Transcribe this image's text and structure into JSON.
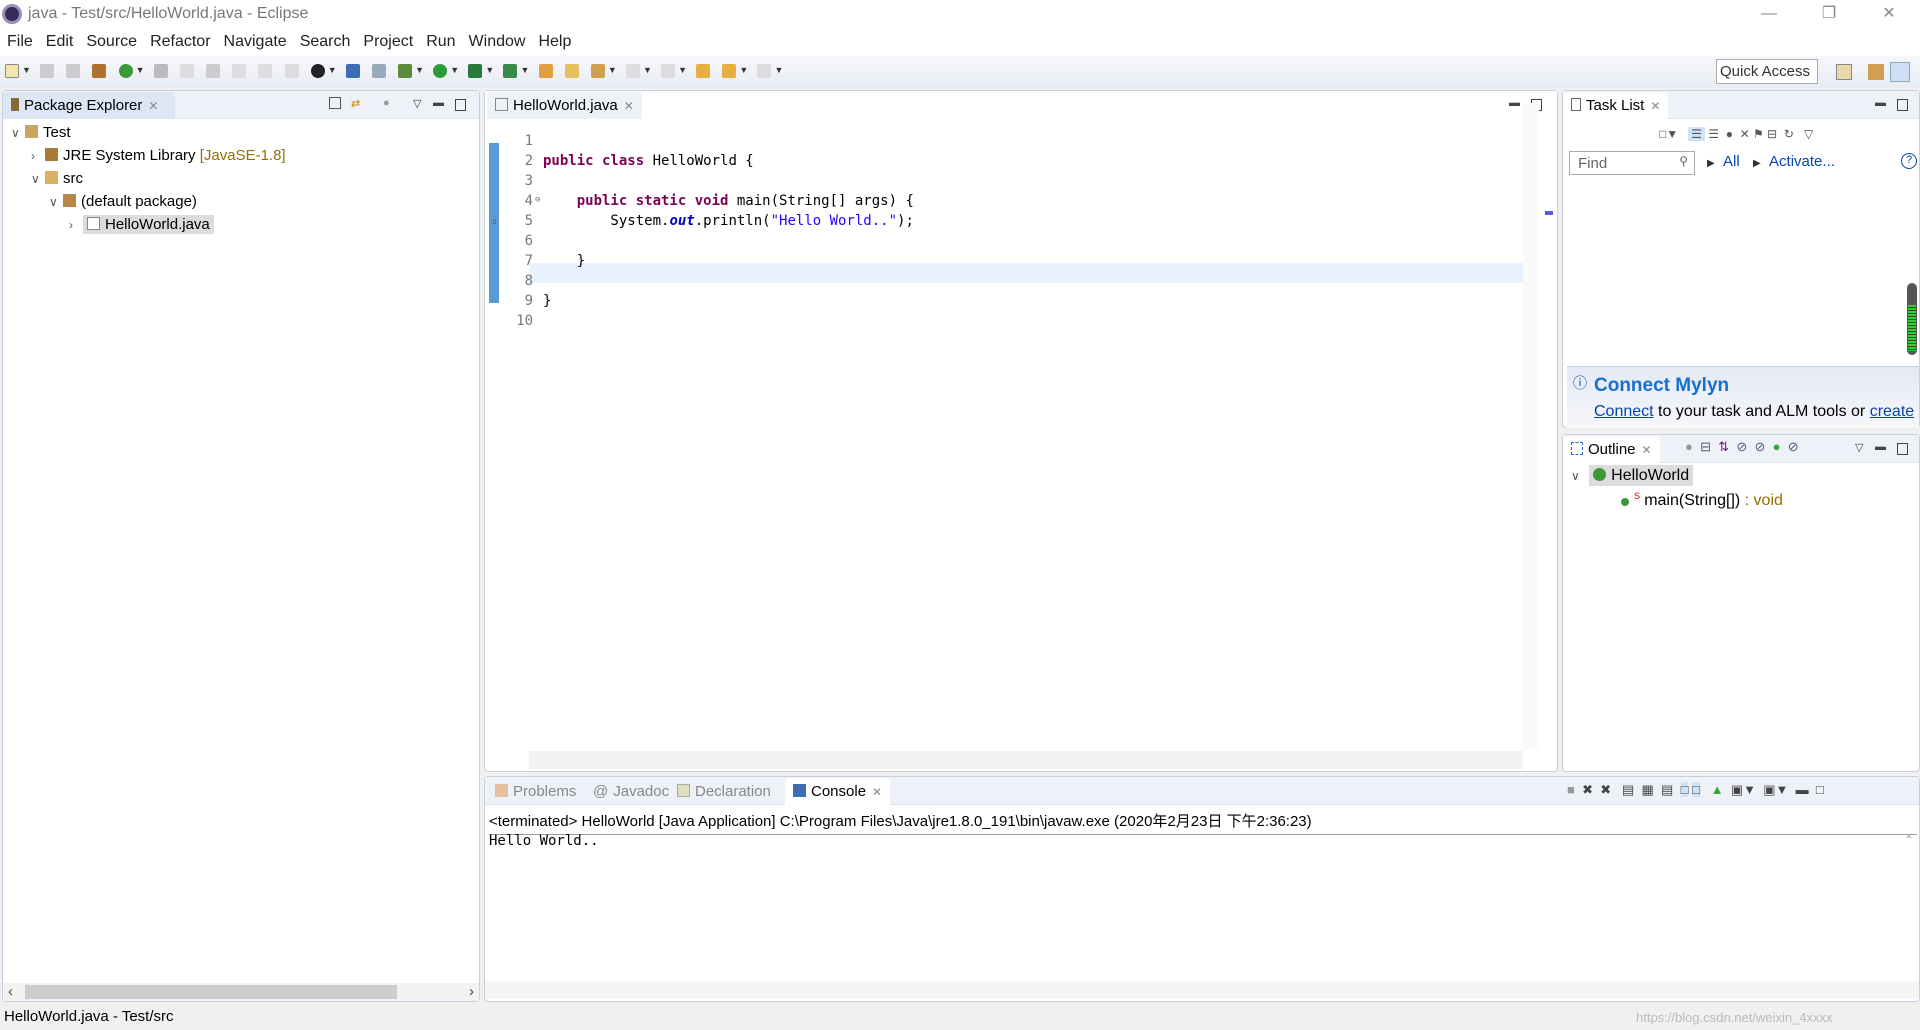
{
  "window": {
    "title": "java - Test/src/HelloWorld.java - Eclipse"
  },
  "menu": [
    "File",
    "Edit",
    "Source",
    "Refactor",
    "Navigate",
    "Search",
    "Project",
    "Run",
    "Window",
    "Help"
  ],
  "toolbar": {
    "quick_access": "Quick Access"
  },
  "package_explorer": {
    "tab": "Package Explorer",
    "tree": [
      {
        "label": "Test",
        "icon": "project-icon"
      },
      {
        "label": "JRE System Library",
        "decoration": "[JavaSE-1.8]",
        "icon": "library-icon"
      },
      {
        "label": "src",
        "icon": "source-folder-icon"
      },
      {
        "label": "(default package)",
        "icon": "package-icon"
      },
      {
        "label": "HelloWorld.java",
        "icon": "java-file-icon",
        "selected": true
      }
    ]
  },
  "editor": {
    "tab": "HelloWorld.java",
    "lines": [
      {
        "n": "1"
      },
      {
        "n": "2"
      },
      {
        "n": "3"
      },
      {
        "n": "4"
      },
      {
        "n": "5"
      },
      {
        "n": "6"
      },
      {
        "n": "7"
      },
      {
        "n": "8"
      },
      {
        "n": "9"
      },
      {
        "n": "10"
      }
    ],
    "code": {
      "l2a": "public class",
      "l2b": " HelloWorld {",
      "l4a": "    public static void",
      "l4b": " main(String[] args) {",
      "l5a": "        System.",
      "l5b": "out",
      "l5c": ".println(",
      "l5d": "\"Hello World..\"",
      "l5e": ");",
      "l7": "    }",
      "l9": "}"
    },
    "current_line": "8"
  },
  "task_list": {
    "tab": "Task List",
    "find_placeholder": "Find",
    "all": "All",
    "activate": "Activate...",
    "mylyn_title": "Connect Mylyn",
    "mylyn_link": "Connect",
    "mylyn_text": " to your task and ALM tools or ",
    "mylyn_link2": "create"
  },
  "outline": {
    "tab": "Outline",
    "items": [
      {
        "label": "HelloWorld"
      },
      {
        "label": "main(String[])",
        "type": " : void"
      }
    ]
  },
  "bottom": {
    "tabs": [
      "Problems",
      "Javadoc",
      "Declaration",
      "Console"
    ],
    "active": "Console",
    "console_header": "<terminated> HelloWorld [Java Application] C:\\Program Files\\Java\\jre1.8.0_191\\bin\\javaw.exe (2020年2月23日 下午2:36:23)",
    "output": "Hello World.."
  },
  "status": {
    "text": "HelloWorld.java - Test/src",
    "watermark": "https://blog.csdn.net/weixin_4xxxx"
  }
}
